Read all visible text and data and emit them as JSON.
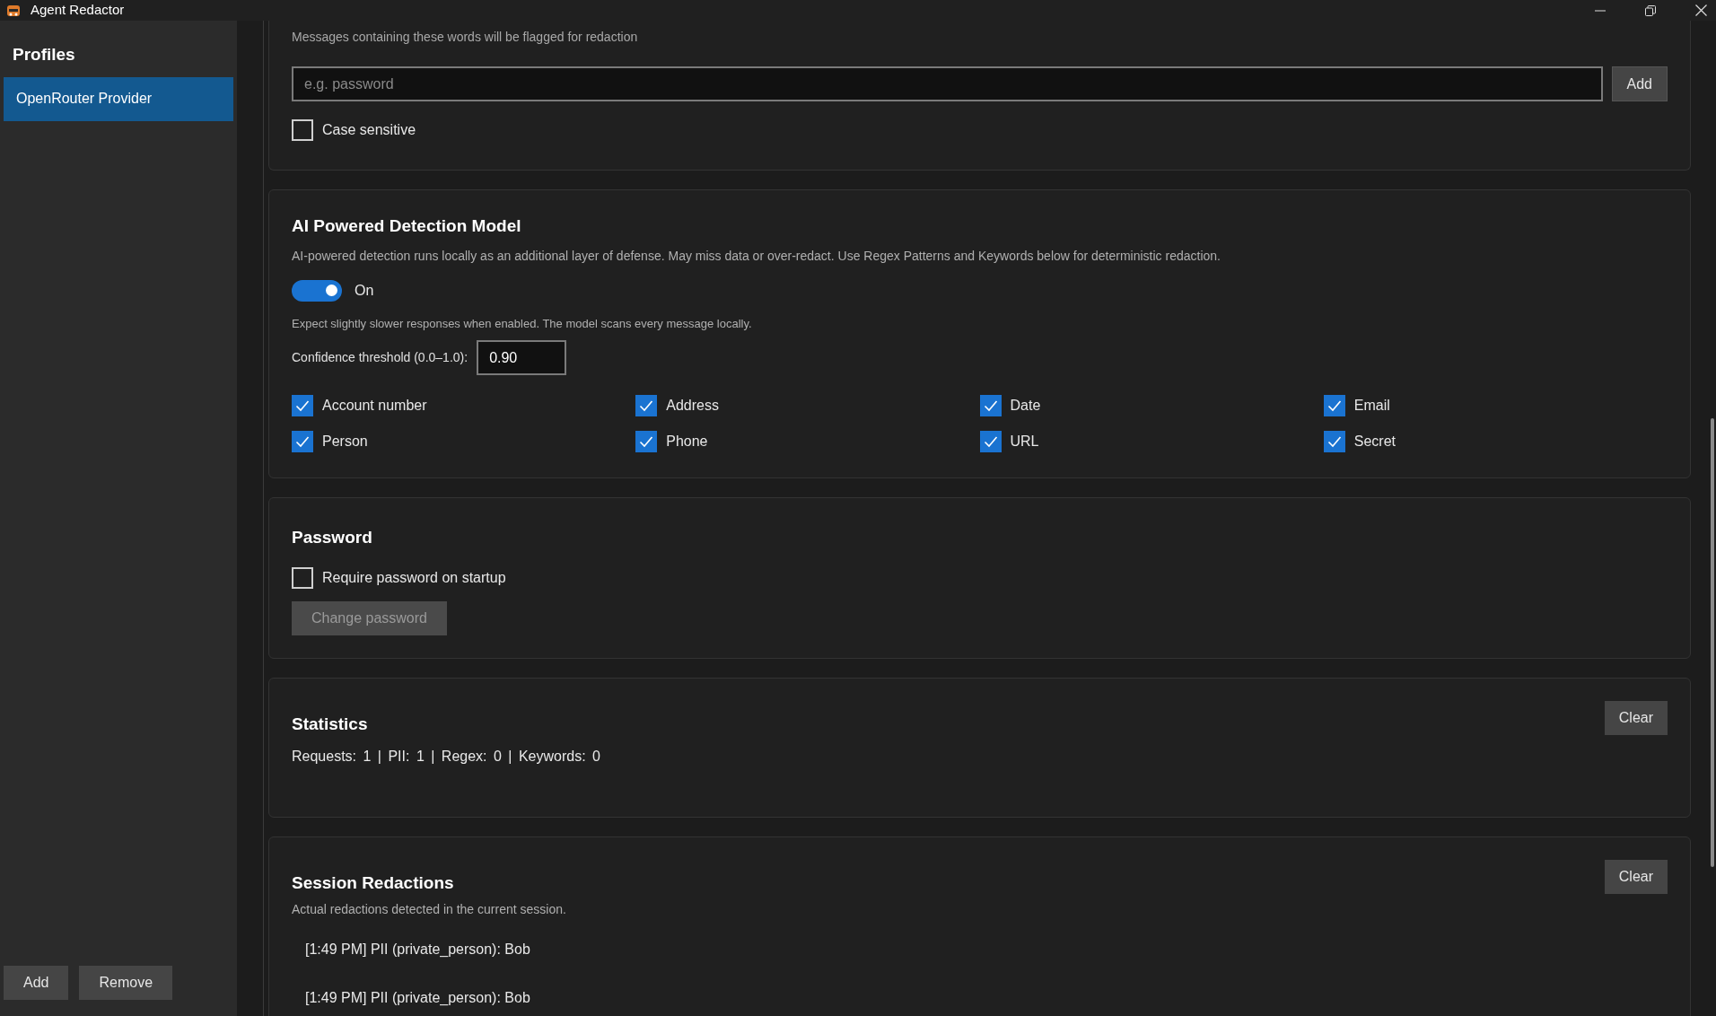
{
  "window": {
    "title": "Agent Redactor"
  },
  "sidebar": {
    "title": "Profiles",
    "items": [
      {
        "label": "OpenRouter Provider",
        "selected": true
      }
    ],
    "buttons": [
      "Add",
      "Remove"
    ]
  },
  "keywords": {
    "description": "Messages containing these words will be flagged for redaction",
    "input": {
      "placeholder": "e.g. password"
    },
    "add_button": "Add",
    "case_sensitive": {
      "label": "Case sensitive",
      "checked": false
    }
  },
  "ai_detection": {
    "title": "AI Powered Detection Model",
    "description": "AI-powered detection runs locally as an additional layer of defense. May miss data or over-redact. Use Regex Patterns and Keywords below for deterministic redaction.",
    "toggle": {
      "on": true,
      "label": "On"
    },
    "note": "Expect slightly slower responses when enabled. The model scans every message locally.",
    "threshold": {
      "label": "Confidence threshold (0.0–1.0):",
      "value": "0.90"
    },
    "categories": [
      {
        "label": "Account number",
        "checked": true
      },
      {
        "label": "Address",
        "checked": true
      },
      {
        "label": "Date",
        "checked": true
      },
      {
        "label": "Email",
        "checked": true
      },
      {
        "label": "Person",
        "checked": true
      },
      {
        "label": "Phone",
        "checked": true
      },
      {
        "label": "URL",
        "checked": true
      },
      {
        "label": "Secret",
        "checked": true
      }
    ]
  },
  "password": {
    "title": "Password",
    "require": {
      "label": "Require password on startup",
      "checked": false
    },
    "change_button": {
      "label": "Change password",
      "disabled": true
    }
  },
  "statistics": {
    "title": "Statistics",
    "clear_button": "Clear",
    "summary": "Requests: 1 | PII: 1 | Regex: 0 | Keywords: 0"
  },
  "session_redactions": {
    "title": "Session Redactions",
    "clear_button": "Clear",
    "description": "Actual redactions detected in the current session.",
    "entries": [
      "[1:49 PM] PII (private_person): Bob",
      "[1:49 PM] PII (private_person): Bob"
    ]
  }
}
